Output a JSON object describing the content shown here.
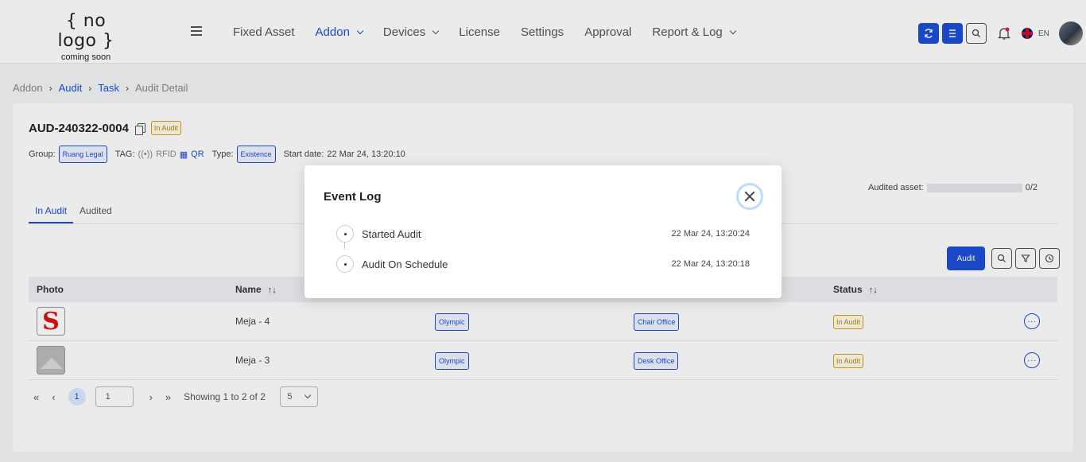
{
  "header": {
    "logo_main": "{ no logo }",
    "logo_sub": "coming soon",
    "nav": [
      {
        "label": "Fixed Asset"
      },
      {
        "label": "Addon"
      },
      {
        "label": "Devices"
      },
      {
        "label": "License"
      },
      {
        "label": "Settings"
      },
      {
        "label": "Approval"
      },
      {
        "label": "Report & Log"
      }
    ],
    "lang": "EN"
  },
  "breadcrumb": [
    "Addon",
    "Audit",
    "Task",
    "Audit Detail"
  ],
  "audit": {
    "id": "AUD-240322-0004",
    "status_badge": "In Audit",
    "group_label": "Group:",
    "group_value": "Ruang Legal",
    "tag_label": "TAG:",
    "tag_rfid": "RFID",
    "tag_qr": "QR",
    "type_label": "Type:",
    "type_value": "Existence",
    "start_label": "Start date:",
    "start_value": "22 Mar 24, 13:20:10",
    "audited_label": "Audited asset:",
    "audited_value": "0/2",
    "audited_progress": 0
  },
  "tabs": [
    "In Audit",
    "Audited"
  ],
  "toolbar": {
    "audit_label": "Audit"
  },
  "table": {
    "headers": {
      "photo": "Photo",
      "name": "Name",
      "status": "Status"
    },
    "rows": [
      {
        "photo_letter": "S",
        "name": "Meja - 4",
        "brand": "Olympic",
        "category": "Chair Office",
        "status": "In Audit"
      },
      {
        "name": "Meja - 3",
        "brand": "Olympic",
        "category": "Desk Office",
        "status": "In Audit"
      }
    ]
  },
  "pagination": {
    "current_page": "1",
    "page_input": "1",
    "showing": "Showing 1 to 2 of 2",
    "per_page": "5"
  },
  "modal": {
    "title": "Event Log",
    "events": [
      {
        "label": "Started Audit",
        "time": "22 Mar 24, 13:20:24"
      },
      {
        "label": "Audit On Schedule",
        "time": "22 Mar 24, 13:20:18"
      }
    ]
  },
  "colors": {
    "accent": "#1d4ed8",
    "warning": "#d4a017",
    "brand_red": "#dd1111"
  }
}
